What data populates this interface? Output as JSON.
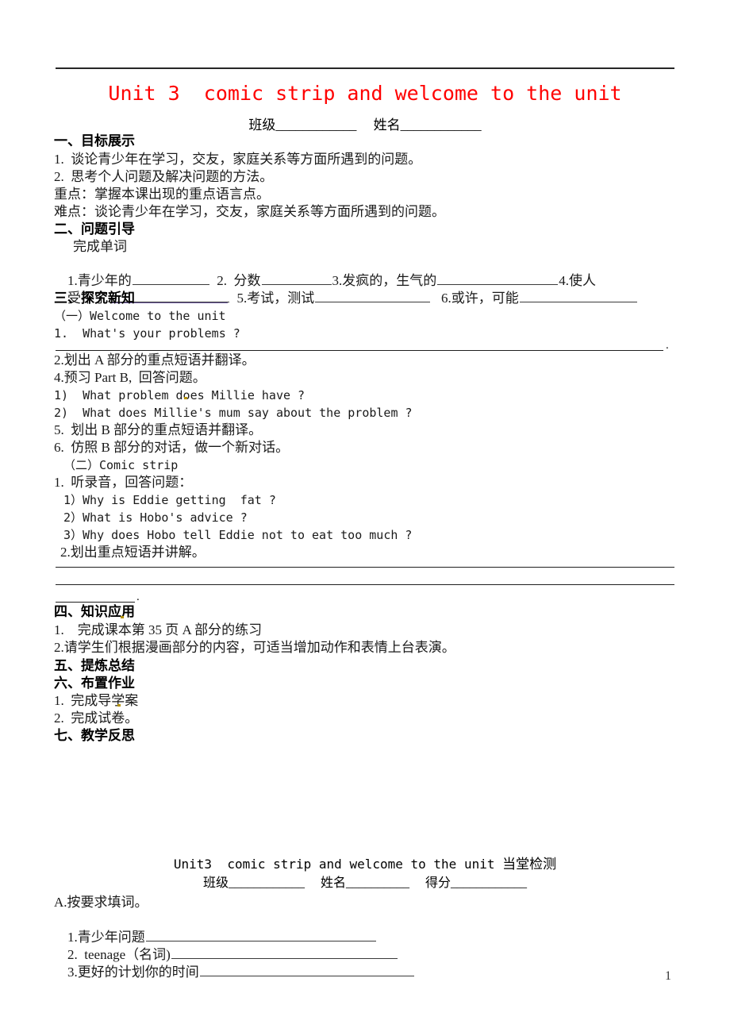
{
  "document": {
    "title": "Unit 3  comic strip and welcome to the unit",
    "title_color": "#ff0000",
    "subline": "班级____________     姓名____________",
    "page_number": "1"
  },
  "sections": {
    "s1_heading": "一、目标展示",
    "s1_items": [
      "1.  谈论青少年在学习，交友，家庭关系等方面所遇到的问题。",
      "2.  思考个人问题及解决问题的方法。",
      "重点：掌握本课出现的重点语言点。",
      "难点：谈论青少年在学习，交友，家庭关系等方面所遇到的问题。"
    ],
    "s2_heading": "二、问题引导",
    "s2_subheading": "完成单词",
    "s2_vocab_line1_a": "1.青少年的",
    "s2_vocab_line1_b": "2.  分数",
    "s2_vocab_line1_c": "3.发疯的，生气的",
    "s2_vocab_line1_d": "4.使人",
    "s2_vocab_line2_a": "受不了",
    "s2_vocab_line2_b": "5.考试，测试",
    "s2_vocab_line2_c": "6.或许，可能",
    "s3_heading": "三、探究新知",
    "s3_part_a": "（一）Welcome to the unit",
    "s3_q1": "1.  What's your problems ?",
    "s3_item2": "2.划出 A 部分的重点短语并翻译。",
    "s3_item4": "4.预习 Part B,  回答问题。",
    "s3_item4_q1": "1)  What problem does Millie have ?",
    "s3_item4_q2": "2)  What does Millie's mum say about the problem ?",
    "s3_item5": "5.  划出 B 部分的重点短语并翻译。",
    "s3_item6": "6.  仿照 B 部分的对话，做一个新对话。",
    "s3_part_b": "（二）Comic strip",
    "s3_b1": "1.  听录音，回答问题：",
    "s3_b1_q1": "1）Why is Eddie getting  fat ?",
    "s3_b1_q2": "2）What is Hobo's advice ?",
    "s3_b1_q3": "3）Why does Hobo tell Eddie not to eat too much ?",
    "s3_b2": "2.划出重点短语并讲解。",
    "s4_heading": "四、知识应用",
    "s4_item1": "1.    完成课本第 35 页 A 部分的练习",
    "s4_item2": "2.请学生们根据漫画部分的内容，可适当增加动作和表情上台表演。",
    "s5_heading": "五、提炼总结",
    "s6_heading": "六、布置作业",
    "s6_item1": "1.  完成导学案",
    "s6_item2": "2.  完成试卷。",
    "s7_heading": "七、教学反思"
  },
  "quiz": {
    "title_en": "Unit3  comic strip and welcome to the unit ",
    "title_cn": "当堂检测",
    "subline": "班级____________     姓名__________     得分____________",
    "section_a": "A.按要求填词。",
    "q1": "1.青少年问题",
    "q2": "2.  teenage（名词)",
    "q3": "3.更好的计划你的时间"
  }
}
